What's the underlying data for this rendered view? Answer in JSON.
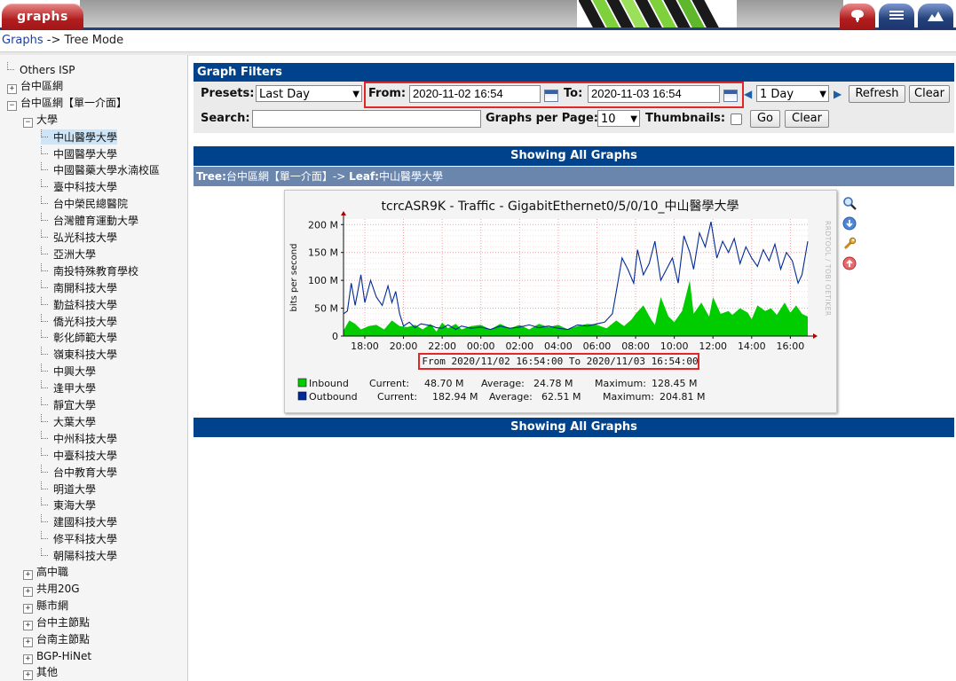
{
  "nav": {
    "tab_graphs": "graphs",
    "breadcrumb_link": "Graphs",
    "breadcrumb_rest": "-> Tree Mode"
  },
  "tree": [
    {
      "label": "Others ISP",
      "kind": "leaf",
      "indent": 0
    },
    {
      "label": "台中區網",
      "kind": "plus",
      "indent": 0
    },
    {
      "label": "台中區網【單一介面】",
      "kind": "minus",
      "indent": 0
    },
    {
      "label": "大學",
      "kind": "minus",
      "indent": 1
    },
    {
      "label": "中山醫學大學",
      "kind": "leaf",
      "indent": 2,
      "selected": true
    },
    {
      "label": "中國醫學大學",
      "kind": "leaf",
      "indent": 2
    },
    {
      "label": "中國醫藥大學水湳校區",
      "kind": "leaf",
      "indent": 2
    },
    {
      "label": "臺中科技大學",
      "kind": "leaf",
      "indent": 2
    },
    {
      "label": "台中榮民總醫院",
      "kind": "leaf",
      "indent": 2
    },
    {
      "label": "台灣體育運動大學",
      "kind": "leaf",
      "indent": 2
    },
    {
      "label": "弘光科技大學",
      "kind": "leaf",
      "indent": 2
    },
    {
      "label": "亞洲大學",
      "kind": "leaf",
      "indent": 2
    },
    {
      "label": "南投特殊教育學校",
      "kind": "leaf",
      "indent": 2
    },
    {
      "label": "南開科技大學",
      "kind": "leaf",
      "indent": 2
    },
    {
      "label": "勤益科技大學",
      "kind": "leaf",
      "indent": 2
    },
    {
      "label": "僑光科技大學",
      "kind": "leaf",
      "indent": 2
    },
    {
      "label": "彰化師範大學",
      "kind": "leaf",
      "indent": 2
    },
    {
      "label": "嶺東科技大學",
      "kind": "leaf",
      "indent": 2
    },
    {
      "label": "中興大學",
      "kind": "leaf",
      "indent": 2
    },
    {
      "label": "逢甲大學",
      "kind": "leaf",
      "indent": 2
    },
    {
      "label": "靜宜大學",
      "kind": "leaf",
      "indent": 2
    },
    {
      "label": "大葉大學",
      "kind": "leaf",
      "indent": 2
    },
    {
      "label": "中州科技大學",
      "kind": "leaf",
      "indent": 2
    },
    {
      "label": "中臺科技大學",
      "kind": "leaf",
      "indent": 2
    },
    {
      "label": "台中教育大學",
      "kind": "leaf",
      "indent": 2
    },
    {
      "label": "明道大學",
      "kind": "leaf",
      "indent": 2
    },
    {
      "label": "東海大學",
      "kind": "leaf",
      "indent": 2
    },
    {
      "label": "建國科技大學",
      "kind": "leaf",
      "indent": 2
    },
    {
      "label": "修平科技大學",
      "kind": "leaf",
      "indent": 2
    },
    {
      "label": "朝陽科技大學",
      "kind": "leaf",
      "indent": 2
    },
    {
      "label": "高中職",
      "kind": "plus",
      "indent": 1
    },
    {
      "label": "共用20G",
      "kind": "plus",
      "indent": 1
    },
    {
      "label": "縣市網",
      "kind": "plus",
      "indent": 1
    },
    {
      "label": "台中主節點",
      "kind": "plus",
      "indent": 1
    },
    {
      "label": "台南主節點",
      "kind": "plus",
      "indent": 1
    },
    {
      "label": "BGP-HiNet",
      "kind": "plus",
      "indent": 1
    },
    {
      "label": "其他",
      "kind": "plus",
      "indent": 1
    }
  ],
  "filters": {
    "header": "Graph Filters",
    "presets_label": "Presets:",
    "presets_value": "Last Day",
    "from_label": "From:",
    "from_value": "2020-11-02 16:54",
    "to_label": "To:",
    "to_value": "2020-11-03 16:54",
    "timespan_value": "1 Day",
    "refresh_label": "Refresh",
    "clear_label": "Clear",
    "search_label": "Search:",
    "search_value": "",
    "gpp_label": "Graphs per Page:",
    "gpp_value": "10",
    "thumbnails_label": "Thumbnails:",
    "go_label": "Go",
    "clear2_label": "Clear"
  },
  "showing_label": "Showing All Graphs",
  "tree_path": {
    "tree_key": "Tree:",
    "tree_value": "台中區網【單一介面】-> ",
    "leaf_key": "Leaf:",
    "leaf_value": "中山醫學大學"
  },
  "graph_icons": [
    "zoom-icon",
    "csv-export-icon",
    "properties-icon",
    "timespan-icon"
  ],
  "chart_data": {
    "type": "area",
    "title": "tcrcASR9K - Traffic - GigabitEthernet0/5/0/10_中山醫學大學",
    "ylabel": "bits per second",
    "watermark": "RRDTOOL / TOBI OETIKER",
    "ylim": [
      0,
      210
    ],
    "yticks": [
      0,
      50,
      100,
      150,
      200
    ],
    "yticklabels": [
      "0",
      "50 M",
      "100 M",
      "150 M",
      "200 M"
    ],
    "xlim_hours": [
      16.9,
      40.9
    ],
    "xticks_hours": [
      18,
      20,
      22,
      24,
      26,
      28,
      30,
      32,
      34,
      36,
      38,
      40
    ],
    "xticklabels": [
      "18:00",
      "20:00",
      "22:00",
      "00:00",
      "02:00",
      "04:00",
      "06:00",
      "08:00",
      "10:00",
      "12:00",
      "14:00",
      "16:00"
    ],
    "range_label": "From 2020/11/02 16:54:00 To 2020/11/03 16:54:00",
    "series": [
      {
        "name": "Inbound",
        "kind": "area",
        "color": "#00cc00",
        "x": [
          16.9,
          17.2,
          17.5,
          17.8,
          18.2,
          18.6,
          19.0,
          19.4,
          19.8,
          20.2,
          20.6,
          21.0,
          21.4,
          21.7,
          22.0,
          22.3,
          22.7,
          23.0,
          23.5,
          24.0,
          24.5,
          25.0,
          25.5,
          26.0,
          26.5,
          27.0,
          27.5,
          28.0,
          28.5,
          29.0,
          29.5,
          30.0,
          30.5,
          31.0,
          31.4,
          31.8,
          32.0,
          32.4,
          32.8,
          33.0,
          33.3,
          33.7,
          34.0,
          34.4,
          34.8,
          35.0,
          35.4,
          35.8,
          36.0,
          36.4,
          36.8,
          37.0,
          37.4,
          37.8,
          38.0,
          38.3,
          38.7,
          39.0,
          39.3,
          39.7,
          40.0,
          40.3,
          40.6,
          40.9
        ],
        "values": [
          10,
          28,
          22,
          12,
          18,
          20,
          12,
          28,
          18,
          16,
          20,
          12,
          22,
          8,
          24,
          14,
          22,
          12,
          18,
          20,
          12,
          22,
          14,
          20,
          12,
          22,
          16,
          20,
          12,
          18,
          22,
          20,
          14,
          28,
          18,
          30,
          40,
          55,
          30,
          20,
          70,
          35,
          25,
          45,
          100,
          40,
          60,
          35,
          70,
          40,
          45,
          38,
          50,
          42,
          30,
          55,
          45,
          50,
          38,
          60,
          42,
          55,
          40,
          35
        ]
      },
      {
        "name": "Outbound",
        "kind": "line",
        "color": "#002a97",
        "x": [
          16.9,
          17.1,
          17.3,
          17.5,
          17.8,
          18.0,
          18.3,
          18.6,
          18.9,
          19.2,
          19.4,
          19.6,
          19.8,
          20.0,
          20.3,
          20.6,
          20.9,
          21.2,
          21.5,
          21.7,
          22.0,
          22.3,
          22.7,
          23.0,
          23.5,
          24.0,
          24.5,
          25.0,
          25.5,
          26.0,
          26.5,
          27.0,
          27.5,
          28.0,
          28.5,
          29.0,
          29.5,
          30.0,
          30.4,
          30.8,
          31.0,
          31.3,
          31.6,
          31.9,
          32.1,
          32.4,
          32.7,
          33.0,
          33.3,
          33.6,
          33.9,
          34.2,
          34.5,
          34.8,
          35.0,
          35.3,
          35.6,
          35.9,
          36.2,
          36.5,
          36.8,
          37.1,
          37.4,
          37.7,
          38.0,
          38.3,
          38.6,
          38.9,
          39.2,
          39.5,
          39.8,
          40.1,
          40.4,
          40.6,
          40.9
        ],
        "values": [
          40,
          45,
          95,
          55,
          110,
          60,
          100,
          70,
          55,
          90,
          60,
          80,
          40,
          18,
          25,
          15,
          22,
          20,
          18,
          15,
          14,
          20,
          12,
          18,
          14,
          16,
          12,
          18,
          14,
          16,
          20,
          15,
          18,
          14,
          12,
          20,
          18,
          22,
          25,
          40,
          80,
          140,
          120,
          95,
          155,
          110,
          130,
          170,
          100,
          120,
          140,
          95,
          180,
          150,
          120,
          185,
          160,
          205,
          140,
          170,
          150,
          175,
          130,
          160,
          140,
          125,
          155,
          135,
          165,
          120,
          150,
          135,
          95,
          110,
          170
        ]
      }
    ],
    "legend": [
      {
        "name": "Inbound",
        "current_label": "Current:",
        "current": "48.70 M",
        "average_label": "Average:",
        "average": "24.78 M",
        "maximum_label": "Maximum:",
        "maximum": "128.45 M"
      },
      {
        "name": "Outbound",
        "current_label": "Current:",
        "current": "182.94 M",
        "average_label": "Average:",
        "average": "62.51 M",
        "maximum_label": "Maximum:",
        "maximum": "204.81 M"
      }
    ]
  }
}
